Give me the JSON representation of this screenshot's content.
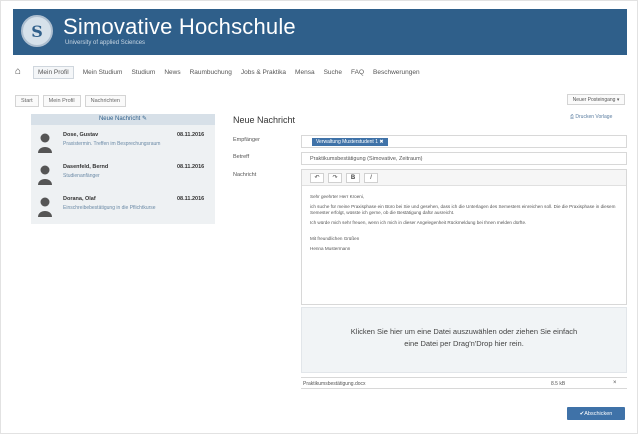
{
  "brand": {
    "title": "Simovative Hochschule",
    "subtitle": "University of applied Sciences"
  },
  "nav": {
    "items": [
      {
        "label": "Mein Profil",
        "active": true
      },
      {
        "label": "Mein Studium",
        "active": false
      },
      {
        "label": "Studium",
        "active": false
      },
      {
        "label": "News",
        "active": false
      },
      {
        "label": "Raumbuchung",
        "active": false
      },
      {
        "label": "Jobs & Praktika",
        "active": false
      },
      {
        "label": "Mensa",
        "active": false
      },
      {
        "label": "Suche",
        "active": false
      },
      {
        "label": "FAQ",
        "active": false
      },
      {
        "label": "Beschwerungen",
        "active": false
      }
    ]
  },
  "breadcrumb": [
    "Start",
    "Mein Profil",
    "Nachrichten"
  ],
  "folder_button": "Neuer Posteingang",
  "messages": {
    "new_label": "Neue Nachricht",
    "items": [
      {
        "name": "Dose, Gustav",
        "date": "08.11.2016",
        "snippet": "Praxistermin. Treffen im Besprechungsraum"
      },
      {
        "name": "Dasenfeld, Bernd",
        "date": "08.11.2016",
        "snippet": "Studienanfänger"
      },
      {
        "name": "Dorana, Olaf",
        "date": "08.11.2016",
        "snippet": "Einschreibebestätigung in die Pflichtkurse"
      }
    ]
  },
  "compose": {
    "title": "Neue Nachricht",
    "print_link": "Drucken Vorlage",
    "labels": {
      "to": "Empfänger",
      "subject": "Betreff",
      "message": "Nachricht"
    },
    "recipient_chip": "Verwaltung Musterstudent 1 ✖",
    "subject_value": "Praktikumsbestätigung (Simovative, Zeitraum)",
    "body": [
      "Sehr geehrter Herr Kroeni,",
      "ich suche für meine Praxisphase ein Büro bei Sie und gesehen, dass ich die Unterlagen des Semesters einreichen soll. Die die Praxisphase in diesem Semester erfolgt, wüsste ich gerne, ob die Bestätigung dafür ausreicht.",
      "Ich würde mich sehr freuen, wenn ich mich in dieser Angelegenheit Rückmeldung bei Ihnen melden dürfte.",
      "Mit freundlichen Grüßen",
      "Henna Mustermann"
    ],
    "dropzone_line1": "Klicken Sie hier um eine Datei auszuwählen oder ziehen Sie einfach",
    "dropzone_line2": "eine Datei per Drag'n'Drop hier rein.",
    "attachment_name": "Praktikumsbestätigung.docx",
    "attachment_size": "8.5 kB",
    "send_label": "Abschicken"
  }
}
